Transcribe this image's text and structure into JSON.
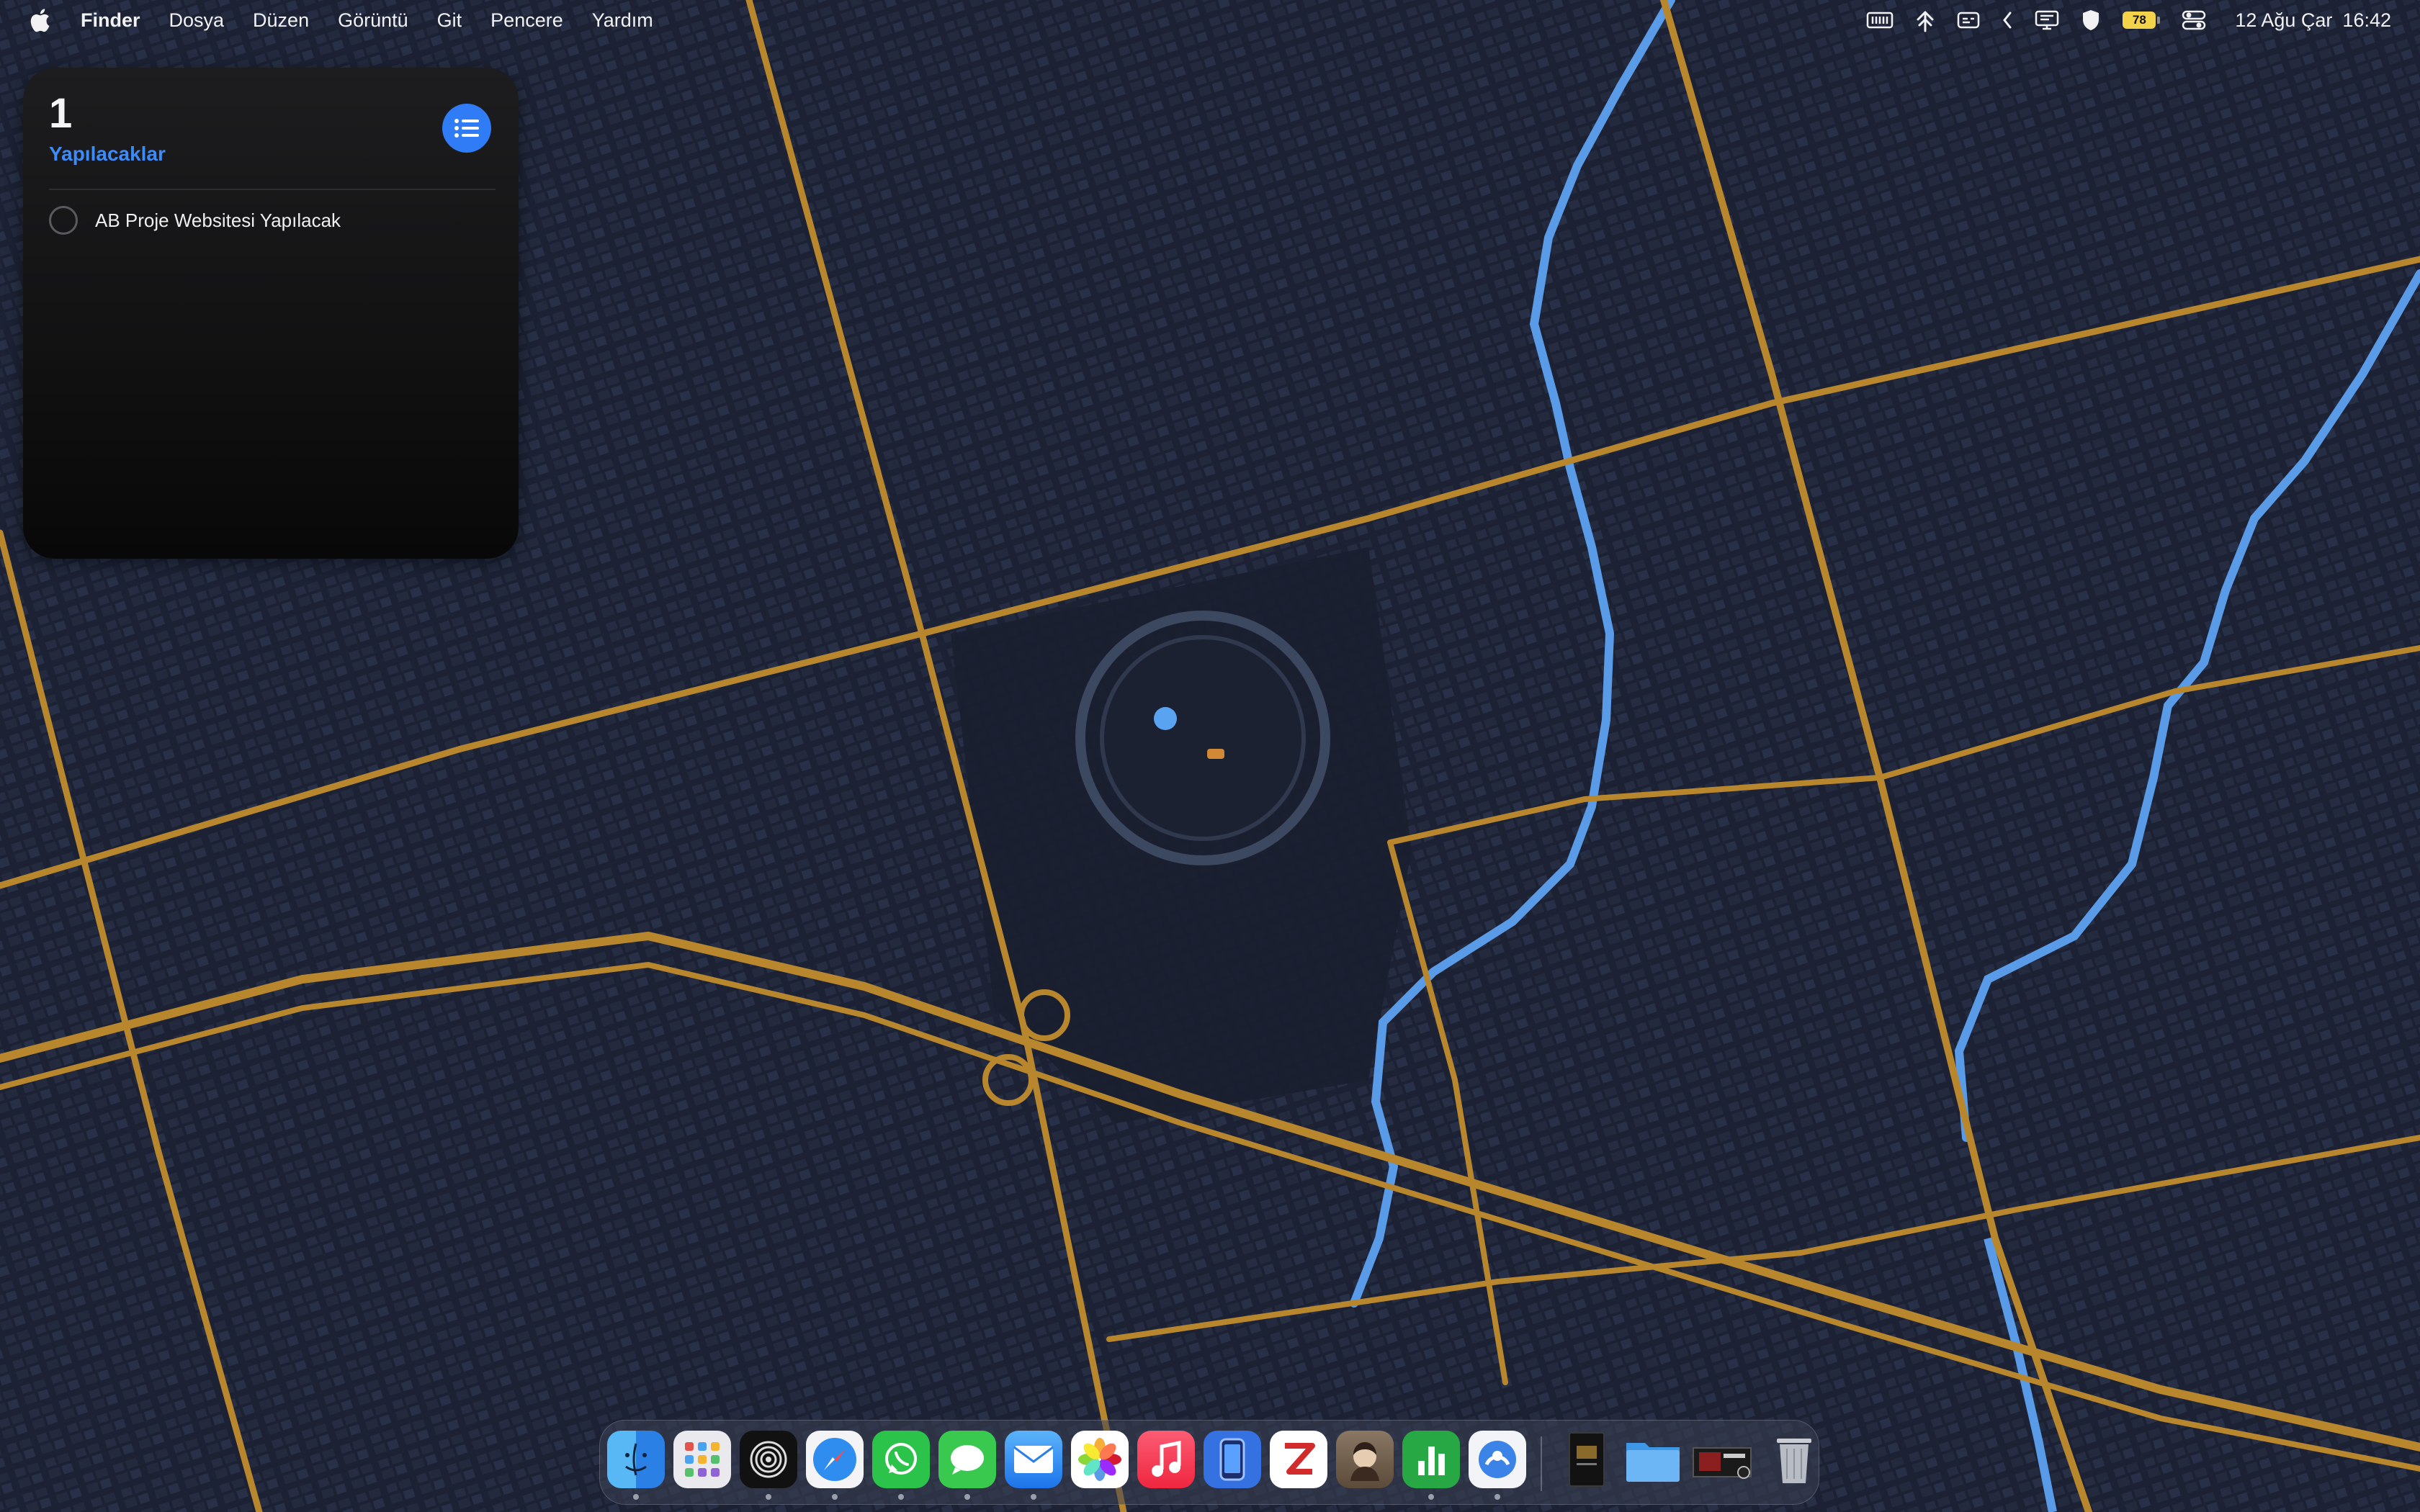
{
  "menubar": {
    "apple_icon": "apple-logo-icon",
    "app_name": "Finder",
    "items": [
      "Dosya",
      "Düzen",
      "Görüntü",
      "Git",
      "Pencere",
      "Yardım"
    ],
    "status_icons": [
      "keyboard-brightness-icon",
      "airdrop-icon",
      "caption-icon",
      "chevron-left-icon",
      "display-icon",
      "shield-icon",
      "battery-icon",
      "control-center-icon"
    ],
    "battery_level": "78",
    "date": "12 Ağu Çar",
    "time": "16:42"
  },
  "widget": {
    "count": "1",
    "title": "Yapılacaklar",
    "list_icon": "list-icon",
    "items": [
      {
        "label": "AB Proje Websitesi Yapılacak",
        "checked": false
      }
    ],
    "accent_color": "#2f7cf6"
  },
  "wallpaper": {
    "description_colors": {
      "background": "#1b2133",
      "roads": "#b8862d",
      "water": "#5a9be8"
    }
  },
  "dock": {
    "apps": [
      {
        "name": "finder-icon",
        "running": true
      },
      {
        "name": "launchpad-icon",
        "running": false
      },
      {
        "name": "siri-icon",
        "running": true
      },
      {
        "name": "safari-icon",
        "running": true
      },
      {
        "name": "whatsapp-icon",
        "running": true
      },
      {
        "name": "messages-icon",
        "running": true
      },
      {
        "name": "mail-icon",
        "running": true
      },
      {
        "name": "photos-icon",
        "running": false
      },
      {
        "name": "music-icon",
        "running": false
      },
      {
        "name": "simulator-icon",
        "running": false
      },
      {
        "name": "zotero-icon",
        "running": false
      },
      {
        "name": "preview-icon",
        "running": false
      },
      {
        "name": "numbers-icon",
        "running": true
      },
      {
        "name": "migration-icon",
        "running": true
      }
    ],
    "stack_items": [
      "book-stack-icon",
      "folder-icon",
      "image-stack-icon",
      "trash-icon"
    ]
  }
}
